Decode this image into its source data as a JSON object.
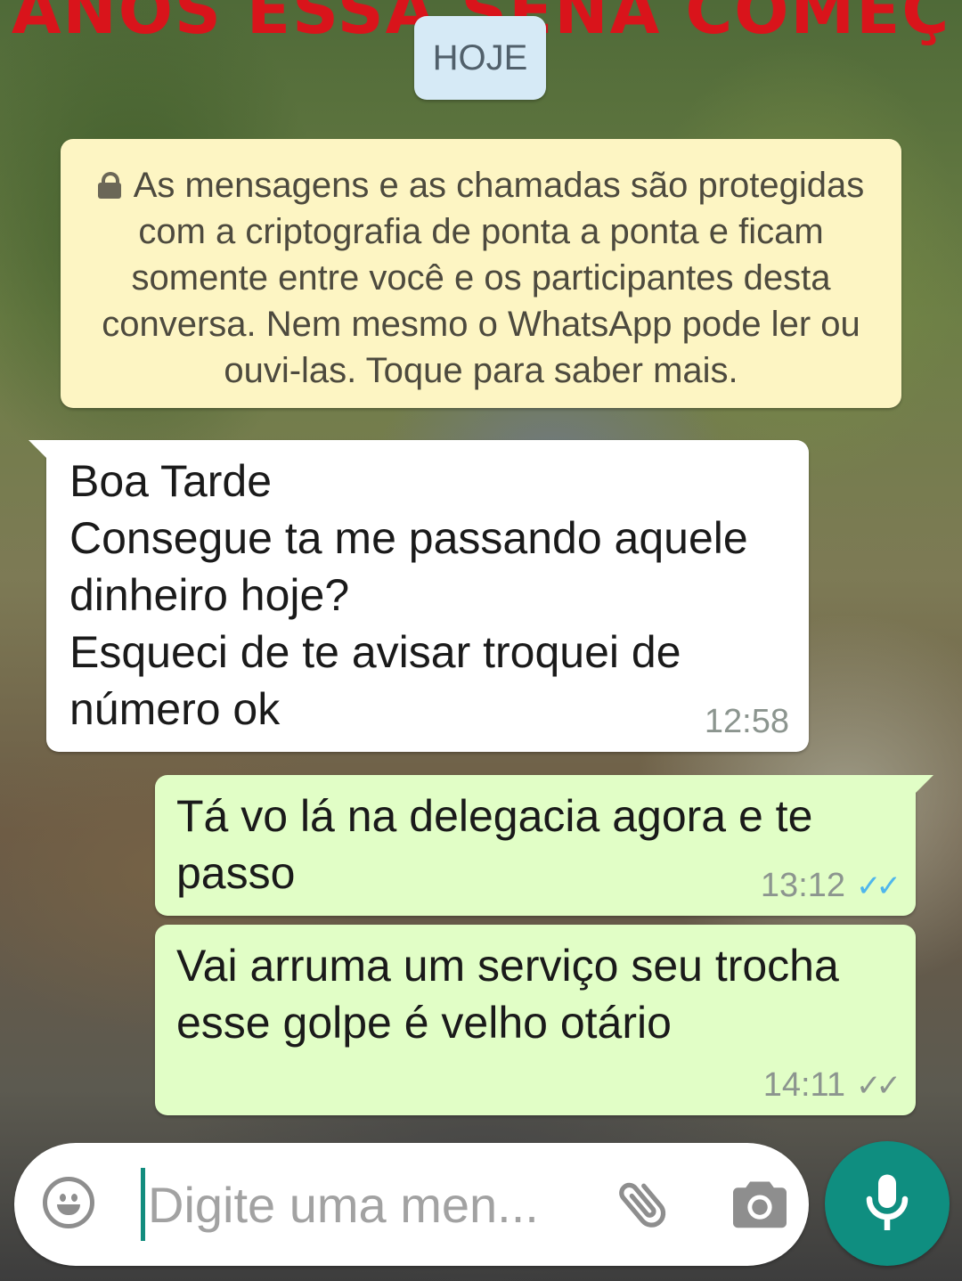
{
  "watermark": {
    "text": "ANOS ESSA SENA COMEÇ"
  },
  "chat": {
    "date_divider": "HOJE",
    "encryption_notice": "As mensagens e as chamadas são protegidas com a criptografia de ponta a ponta e ficam somente entre você e os participantes desta conversa. Nem mesmo o WhatsApp pode ler ou ouvi-las. Toque para saber mais.",
    "messages": [
      {
        "direction": "incoming",
        "text": "Boa Tarde\nConsegue ta me passando aquele dinheiro hoje?\nEsqueci de te avisar troquei de número ok",
        "time": "12:58"
      },
      {
        "direction": "outgoing",
        "text": "Tá vo lá na delegacia agora e te passo",
        "time": "13:12",
        "status": "read",
        "status_icon": "double-check-icon"
      },
      {
        "direction": "outgoing",
        "text": "Vai arruma um serviço seu trocha esse golpe é velho otário",
        "time": "14:11",
        "status": "delivered",
        "status_icon": "double-check-icon"
      }
    ]
  },
  "composer": {
    "placeholder": "Digite uma men...",
    "value": "",
    "icons": [
      "emoji-icon",
      "attach-icon",
      "camera-icon",
      "mic-icon"
    ]
  },
  "colors": {
    "incoming_bubble": "#ffffff",
    "outgoing_bubble": "#e1fec6",
    "notice_bubble": "#fdf5c3",
    "date_chip": "#d6eaf6",
    "read_ticks": "#4fb6ec",
    "delivered_ticks": "#8c958f",
    "mic_button": "#0f8e80",
    "watermark": "#d9141b"
  }
}
